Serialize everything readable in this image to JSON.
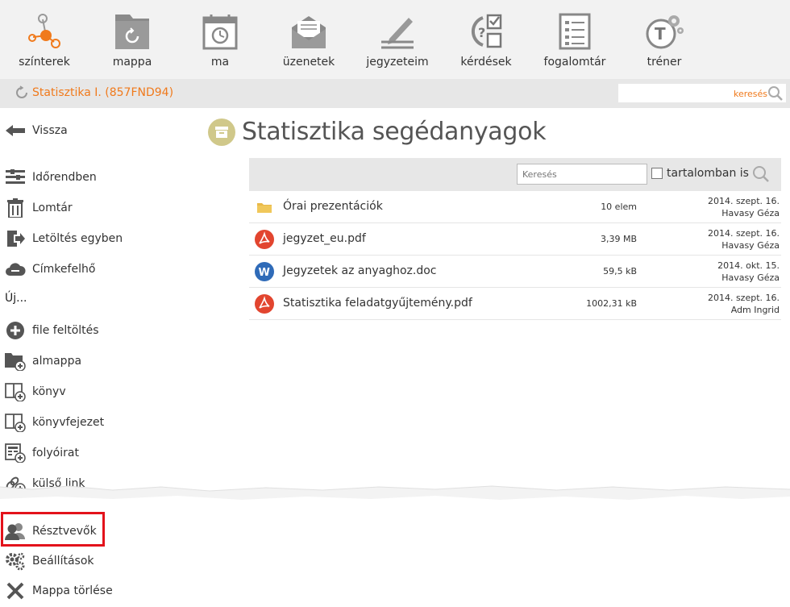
{
  "topnav": {
    "items": [
      {
        "label": "színterek",
        "icon": "network-icon"
      },
      {
        "label": "mappa",
        "icon": "folder-icon"
      },
      {
        "label": "ma",
        "icon": "calendar-icon"
      },
      {
        "label": "üzenetek",
        "icon": "envelope-icon"
      },
      {
        "label": "jegyzeteim",
        "icon": "pencil-icon"
      },
      {
        "label": "kérdések",
        "icon": "checklist-icon"
      },
      {
        "label": "fogalomtár",
        "icon": "glossary-icon"
      },
      {
        "label": "tréner",
        "icon": "trainer-icon"
      }
    ]
  },
  "breadcrumb": {
    "label": "Statisztika I. (857FND94)"
  },
  "top_search": {
    "placeholder": "keresés"
  },
  "sidebar": {
    "back": "Vissza",
    "items": [
      {
        "label": "Időrendben"
      },
      {
        "label": "Lomtár"
      },
      {
        "label": "Letöltés egyben"
      },
      {
        "label": "Címkefelhő"
      }
    ],
    "new_heading": "Új...",
    "new_items": [
      {
        "label": "file feltöltés"
      },
      {
        "label": "almappa"
      },
      {
        "label": "könyv"
      },
      {
        "label": "könyvfejezet"
      },
      {
        "label": "folyóirat"
      },
      {
        "label": "külső link"
      }
    ],
    "bottom_items": [
      {
        "label": "Résztvevők"
      },
      {
        "label": "Beállítások"
      },
      {
        "label": "Mappa törlése"
      }
    ]
  },
  "main": {
    "title": "Statisztika segédanyagok",
    "search_placeholder": "Keresés",
    "checkbox_label": "tartalomban is",
    "files": [
      {
        "name": "Órai prezentációk",
        "type": "folder",
        "size": "10 elem",
        "date": "2014. szept. 16.",
        "owner": "Havasy Géza"
      },
      {
        "name": "jegyzet_eu.pdf",
        "type": "pdf",
        "size": "3,39 MB",
        "date": "2014. szept. 16.",
        "owner": "Havasy Géza"
      },
      {
        "name": "Jegyzetek az anyaghoz.doc",
        "type": "word",
        "size": "59,5 kB",
        "date": "2014. okt. 15.",
        "owner": "Havasy Géza"
      },
      {
        "name": "Statisztika feladatgyűjtemény.pdf",
        "type": "pdf",
        "size": "1002,31 kB",
        "date": "2014. szept. 16.",
        "owner": "Adm Ingrid"
      }
    ]
  },
  "colors": {
    "accent": "#f07a1c",
    "highlight": "#e3121b",
    "pdf": "#e2452f",
    "word": "#2f6bb8",
    "folder": "#e9b949"
  }
}
